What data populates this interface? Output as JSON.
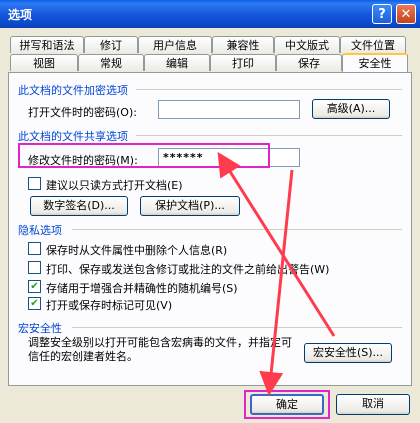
{
  "window": {
    "title": "选项",
    "help_glyph": "?",
    "close_glyph": "✕"
  },
  "tabs_row1": [
    "拼写和语法",
    "修订",
    "用户信息",
    "兼容性",
    "中文版式",
    "文件位置"
  ],
  "tabs_row2": [
    "视图",
    "常规",
    "编辑",
    "打印",
    "保存",
    "安全性"
  ],
  "encrypt": {
    "heading": "此文档的文件加密选项",
    "open_password_label": "打开文件时的密码(O):",
    "open_password_value": "",
    "advanced_button": "高级(A)..."
  },
  "share": {
    "heading": "此文档的文件共享选项",
    "modify_password_label": "修改文件时的密码(M):",
    "modify_password_value": "******",
    "readonly_label": "建议以只读方式打开文档(E)",
    "readonly_checked": false,
    "signature_button": "数字签名(D)...",
    "protect_button": "保护文档(P)..."
  },
  "privacy": {
    "heading": "隐私选项",
    "items": [
      {
        "label": "保存时从文件属性中删除个人信息(R)",
        "checked": false
      },
      {
        "label": "打印、保存或发送包含修订或批注的文件之前给出警告(W)",
        "checked": false
      },
      {
        "label": "存储用于增强合并精确性的随机编号(S)",
        "checked": true
      },
      {
        "label": "打开或保存时标记可见(V)",
        "checked": true
      }
    ]
  },
  "macro": {
    "heading": "宏安全性",
    "description": "调整安全级别以打开可能包含宏病毒的文件，并指定可信任的宏创建者姓名。",
    "button": "宏安全性(S)..."
  },
  "footer": {
    "ok": "确定",
    "cancel": "取消"
  },
  "colors": {
    "highlight": "#e024c8",
    "arrow": "#ff3b4e",
    "section": "#0046d5"
  }
}
